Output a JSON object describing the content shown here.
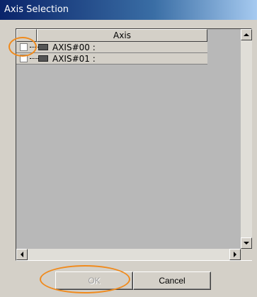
{
  "window": {
    "title": "Axis Selection"
  },
  "list": {
    "column_header": "Axis",
    "rows": [
      {
        "label": "AXIS#00 :",
        "checked": false
      },
      {
        "label": "AXIS#01 :",
        "checked": false
      }
    ]
  },
  "buttons": {
    "ok_label": "OK",
    "cancel_label": "Cancel"
  },
  "icons": {
    "scroll_up": "arrow-up-icon",
    "scroll_down": "arrow-down-icon",
    "scroll_left": "arrow-left-icon",
    "scroll_right": "arrow-right-icon",
    "axis": "axis-icon"
  },
  "colors": {
    "titlebar_start": "#0a246a",
    "highlight_annotation": "#f08a1c"
  }
}
